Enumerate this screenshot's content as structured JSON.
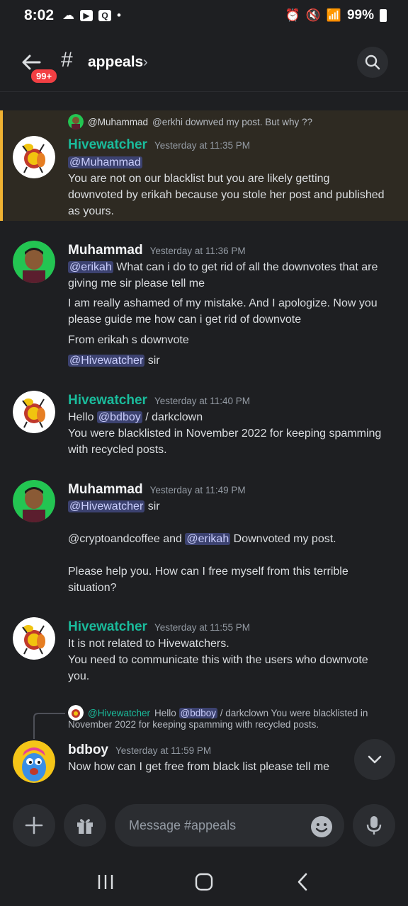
{
  "status_bar": {
    "time": "8:02",
    "battery": "99%",
    "app_badge": "Q"
  },
  "header": {
    "unread_badge": "99+",
    "hash": "#",
    "channel": "appeals"
  },
  "messages": [
    {
      "reply": {
        "name": "@Muhammad",
        "text": "@erkhi downved my post. But why ??"
      },
      "author": "Hivewatcher",
      "timestamp": "Yesterday at 11:35 PM",
      "lines": [
        "@Muhammad",
        "You are not on our blacklist but you are likely getting",
        "downvoted by erikah because you stole her post and published",
        "as yours."
      ]
    },
    {
      "author": "Muhammad",
      "timestamp": "Yesterday at 11:36 PM",
      "mention1": "@erikah",
      "l1_rest": " What can i do to get rid of all the downvotes that are",
      "l2": "giving me sir please tell me",
      "l3": "I am really ashamed of my mistake. And I apologize. Now you",
      "l4": "please guide me how can i get rid of downvote",
      "l5": "From erikah s downvote",
      "mention2": "@Hivewatcher",
      "l6_rest": " sir"
    },
    {
      "author": "Hivewatcher",
      "timestamp": "Yesterday at 11:40 PM",
      "hello": "Hello ",
      "mention": "@bdboy",
      "hello_rest": " / darkclown",
      "l2": "You were blacklisted in November 2022 for keeping spamming",
      "l3": "with recycled posts."
    },
    {
      "author": "Muhammad",
      "timestamp": "Yesterday at 11:49 PM",
      "mention1": "@Hivewatcher",
      "l1_rest": " sir",
      "l2_start": "@cryptoandcoffee and ",
      "mention2": "@erikah",
      "l2_rest": " Downvoted my post.",
      "l3": "Please help you. How can I free myself from this terrible",
      "l4": "situation?"
    },
    {
      "author": "Hivewatcher",
      "timestamp": "Yesterday at 11:55 PM",
      "l1": "It is not related to Hivewatchers.",
      "l2": "You need to communicate this with the users who downvote",
      "l3": "you."
    },
    {
      "reply": {
        "name": "@Hivewatcher",
        "hello": " Hello ",
        "mention": "@bdboy",
        "text": " / darkclown  You were blacklisted in",
        "text2": "November 2022 for keeping spamming with recycled posts."
      },
      "author": "bdboy",
      "timestamp": "Yesterday at 11:59 PM",
      "l1": "Now how can I get free from black list please tell me"
    }
  ],
  "composer": {
    "placeholder": "Message #appeals"
  },
  "colors": {
    "accent_hivewatcher": "#1abc9c",
    "mention_bg": "#3c4270",
    "highlight_border": "#f0b232",
    "badge_red": "#f23f43"
  }
}
